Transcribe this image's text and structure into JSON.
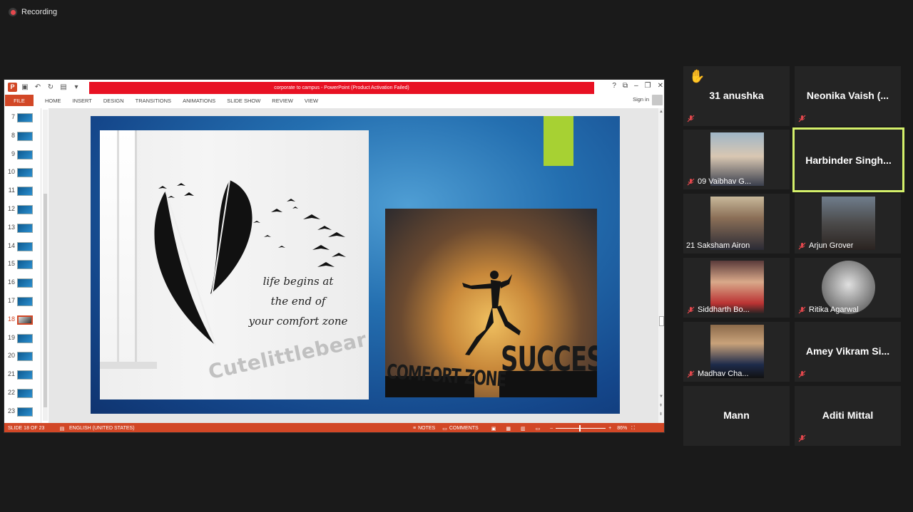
{
  "recording": {
    "label": "Recording"
  },
  "powerpoint": {
    "title": "corporate to campus -  PowerPoint (Product Activation Failed)",
    "file_tab": "FILE",
    "tabs": [
      "HOME",
      "INSERT",
      "DESIGN",
      "TRANSITIONS",
      "ANIMATIONS",
      "SLIDE SHOW",
      "REVIEW",
      "VIEW"
    ],
    "sign_in": "Sign in",
    "window_controls": [
      "?",
      "⧉",
      "–",
      "❐",
      "✕"
    ],
    "thumbnails": [
      "7",
      "8",
      "9",
      "10",
      "11",
      "12",
      "13",
      "14",
      "15",
      "16",
      "17",
      "18",
      "19",
      "20",
      "21",
      "22",
      "23"
    ],
    "selected_slide": "18",
    "slide": {
      "quote_line1": "life begins at",
      "quote_line2": "the end of",
      "quote_line3": "your comfort zone",
      "watermark": "Cutelittlebear",
      "comfort_zone": "COMFORT ZONE",
      "success": "SUCCESS"
    },
    "status": {
      "slide_of": "SLIDE 18 OF 23",
      "language": "ENGLISH (UNITED STATES)",
      "notes": "NOTES",
      "comments": "COMMENTS",
      "zoom": "86%"
    }
  },
  "participants": [
    {
      "name": "31 anushka",
      "hand_raised": true,
      "muted": true
    },
    {
      "name": "Neonika Vaish (...",
      "muted": true
    },
    {
      "label": "09 Vaibhav G...",
      "muted": true,
      "video": true
    },
    {
      "name": "Harbinder  Singh...",
      "active": true
    },
    {
      "label": "21 Saksham Airon",
      "muted": false,
      "video": true
    },
    {
      "label": "Arjun Grover",
      "muted": true,
      "video": true
    },
    {
      "label": "Siddharth Bo...",
      "muted": true,
      "video": true
    },
    {
      "label": "Ritika Agarwal",
      "muted": true,
      "video": true
    },
    {
      "label": "Madhav Cha...",
      "muted": true,
      "video": true
    },
    {
      "name": "Amey Vikram Si...",
      "muted": true
    },
    {
      "name": "Mann",
      "muted": false
    },
    {
      "name": "Aditi Mittal",
      "muted": true
    }
  ],
  "colors": {
    "accent_ppt": "#d24726",
    "active_speaker": "#d4f06a",
    "muted_icon": "#e5484d",
    "background": "#1a1a1a"
  }
}
